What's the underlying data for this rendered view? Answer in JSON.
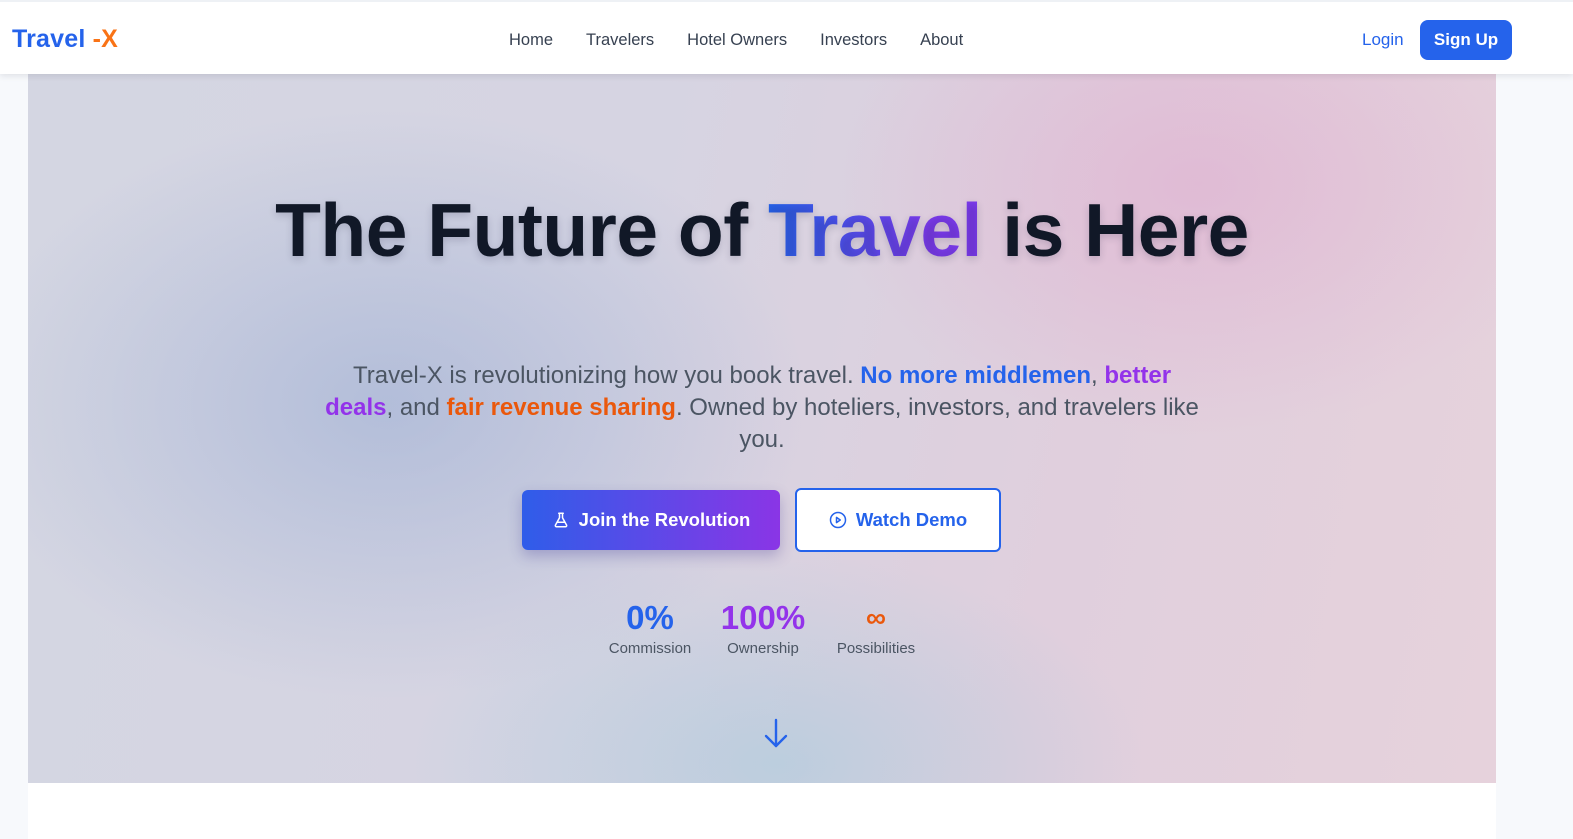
{
  "nav": {
    "logo_main": "Travel ",
    "logo_accent": "-X",
    "links": [
      "Home",
      "Travelers",
      "Hotel Owners",
      "Investors",
      "About"
    ],
    "login": "Login",
    "signup": "Sign Up"
  },
  "hero": {
    "title_part1": "The Future of ",
    "title_accent": "Travel",
    "title_part2": " is Here",
    "sub_intro": "Travel-X is revolutionizing how you book travel. ",
    "sub_hl1": "No more middlemen",
    "sub_sep1": ", ",
    "sub_hl2": "better deals",
    "sub_sep2": ", and ",
    "sub_hl3": "fair revenue sharing",
    "sub_outro": ". Owned by hoteliers, investors, and travelers like you.",
    "primary_button": "Join the Revolution",
    "primary_icon": "flask-icon",
    "secondary_button": "Watch Demo",
    "secondary_icon": "play-circle-icon",
    "scroll_icon": "arrow-down-icon",
    "stats": [
      {
        "value": "0%",
        "label": "Commission",
        "color": "#2563eb"
      },
      {
        "value": "100%",
        "label": "Ownership",
        "color": "#9333ea"
      },
      {
        "value": "∞",
        "label": "Possibilities",
        "color": "#ea580c"
      }
    ]
  },
  "colors": {
    "brand_blue": "#2563eb",
    "brand_orange": "#f97316",
    "brand_purple": "#9333ea"
  }
}
